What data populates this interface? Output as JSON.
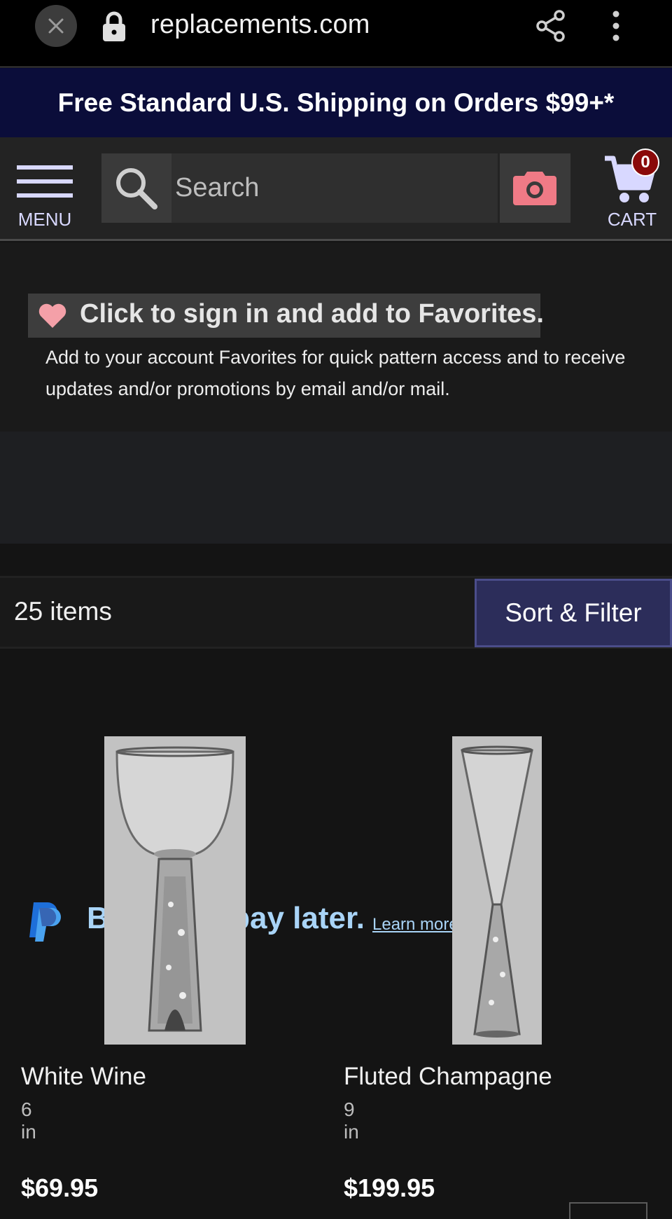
{
  "browser": {
    "url": "replacements.com",
    "close_icon": "close-icon",
    "lock_icon": "lock-icon",
    "share_icon": "share-icon",
    "menu_icon": "kebab-menu-icon"
  },
  "promo": {
    "text": "Free Standard U.S. Shipping on Orders $99+*"
  },
  "header": {
    "menu_label": "MENU",
    "search_placeholder": "Search",
    "cart_label": "CART",
    "cart_count": "0",
    "camera_color": "#f07a86"
  },
  "favorites": {
    "button_label": "Click to sign in and add to Favorites.",
    "description": "Add to your account Favorites for quick pattern access and to receive updates and/or promotions by email and/or mail.",
    "heart_color": "#f4a0a8"
  },
  "paypal": {
    "tagline": "Buy now, pay later.",
    "link": "Learn more"
  },
  "listing": {
    "count": "25 items",
    "sort_label": "Sort & Filter"
  },
  "products": [
    {
      "name": "White Wine",
      "size": "6 in",
      "price": "$69.95"
    },
    {
      "name": "Fluted Champagne",
      "size": "9 in",
      "price": "$199.95"
    }
  ]
}
